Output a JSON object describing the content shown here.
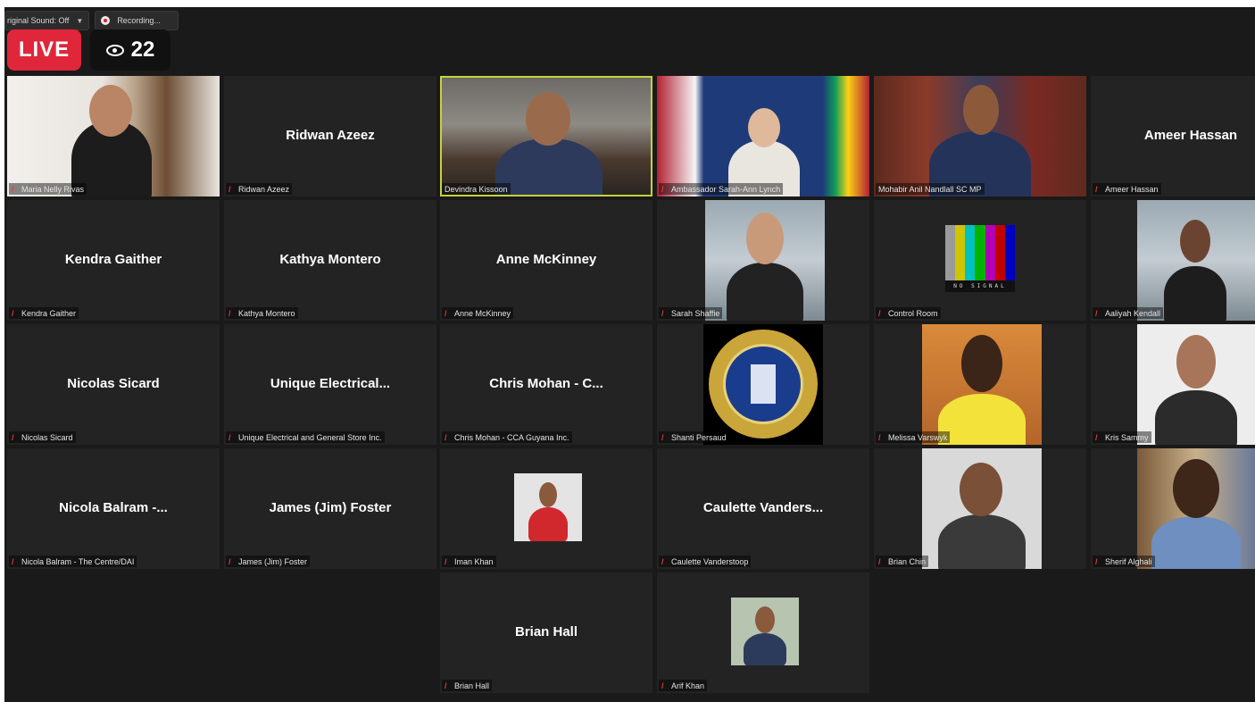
{
  "toolbar": {
    "sound_label": "riginal Sound: Off",
    "recording_label": "Recording..."
  },
  "live_badge": "LIVE",
  "viewer_count": "22",
  "tiles": [
    {
      "big": "",
      "label": "Maria Nelly Rivas"
    },
    {
      "big": "Ridwan Azeez",
      "label": "Ridwan Azeez"
    },
    {
      "big": "",
      "label": "Devindra Kissoon"
    },
    {
      "big": "",
      "label": "Ambassador Sarah-Ann Lynch"
    },
    {
      "big": "",
      "label": "Mohabir Anil Nandlall SC MP"
    },
    {
      "big": "Ameer Hassan",
      "label": "Ameer Hassan"
    },
    {
      "big": "Kendra Gaither",
      "label": "Kendra Gaither"
    },
    {
      "big": "Kathya Montero",
      "label": "Kathya Montero"
    },
    {
      "big": "Anne McKinney",
      "label": "Anne McKinney"
    },
    {
      "big": "",
      "label": "Sarah Shaffie"
    },
    {
      "big": "",
      "label": "Control Room"
    },
    {
      "big": "",
      "label": "Aaliyah Kendall"
    },
    {
      "big": "Nicolas Sicard",
      "label": "Nicolas Sicard"
    },
    {
      "big": "Unique Electrical...",
      "label": "Unique Electrical and General Store Inc."
    },
    {
      "big": "Chris Mohan - C...",
      "label": "Chris Mohan - CCA Guyana Inc."
    },
    {
      "big": "",
      "label": "Shanti Persaud"
    },
    {
      "big": "",
      "label": "Melissa Varswyk"
    },
    {
      "big": "",
      "label": "Kris Sammy"
    },
    {
      "big": "Nicola Balram -...",
      "label": "Nicola Balram - The Centre/DAI"
    },
    {
      "big": "James (Jim) Foster",
      "label": "James (Jim) Foster"
    },
    {
      "big": "",
      "label": "Iman Khan"
    },
    {
      "big": "Caulette Vanders...",
      "label": "Caulette Vanderstoop"
    },
    {
      "big": "",
      "label": "Brian Chin"
    },
    {
      "big": "",
      "label": "Sherif Alghali"
    },
    {
      "big": "Brian Hall",
      "label": "Brian Hall"
    },
    {
      "big": "",
      "label": "Arif Khan"
    }
  ],
  "no_signal_text": "NO SIGNAL",
  "active_speaker_color": "#c6d23a",
  "live_color": "#e0263a"
}
